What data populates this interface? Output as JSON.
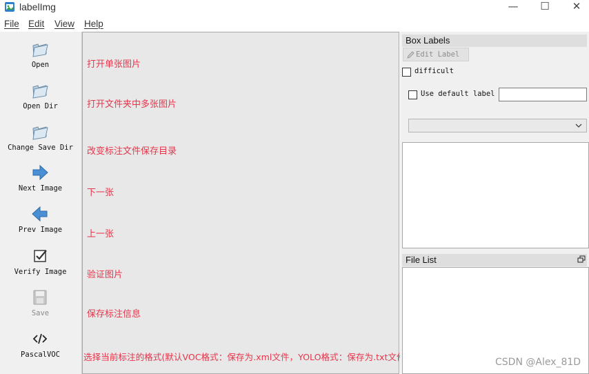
{
  "window": {
    "title": "labelImg",
    "controls": {
      "minimize": "—",
      "maximize": "☐",
      "close": "✕"
    }
  },
  "menu": [
    {
      "label": "File"
    },
    {
      "label": "Edit"
    },
    {
      "label": "View"
    },
    {
      "label": "Help"
    }
  ],
  "toolbar": {
    "items": [
      {
        "label": "Open",
        "icon": "open-folder-icon",
        "enabled": true
      },
      {
        "label": "Open Dir",
        "icon": "open-dir-icon",
        "enabled": true
      },
      {
        "label": "Change Save Dir",
        "icon": "save-dir-icon",
        "enabled": true
      },
      {
        "label": "Next Image",
        "icon": "arrow-right-icon",
        "enabled": true
      },
      {
        "label": "Prev Image",
        "icon": "arrow-left-icon",
        "enabled": true
      },
      {
        "label": "Verify Image",
        "icon": "checkbox-icon",
        "enabled": true
      },
      {
        "label": "Save",
        "icon": "floppy-disk-icon",
        "enabled": false
      },
      {
        "label": "PascalVOC",
        "icon": "code-icon",
        "enabled": true
      }
    ]
  },
  "annotations": [
    "打开单张图片",
    "打开文件夹中多张图片",
    "改变标注文件保存目录",
    "下一张",
    "上一张",
    "验证图片",
    "保存标注信息",
    "选择当前标注的格式(默认VOC格式：保存为.xml文件，YOLO格式：保存为.txt文件，CreateML格式：保存为.josn文件"
  ],
  "box_labels": {
    "title": "Box Labels",
    "edit_label_button": "Edit Label",
    "difficult_label": "difficult",
    "use_default_label": "Use default label",
    "default_label_value": "",
    "combo_value": ""
  },
  "file_list": {
    "title": "File List"
  },
  "watermark": "CSDN @Alex_81D",
  "colors": {
    "annotation_text": "#e8344a",
    "canvas_bg": "#e8e8e8",
    "panel_bg": "#f0f0f0",
    "dock_title_bg": "#dedede"
  }
}
